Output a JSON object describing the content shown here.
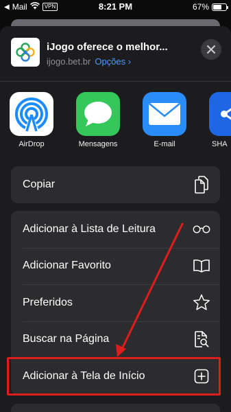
{
  "status_bar": {
    "carrier": "Mail",
    "vpn": "VPN",
    "time": "8:21 PM",
    "battery_percent": "67%",
    "battery_level": 0.67
  },
  "share_header": {
    "title": "iJogo oferece o melhor...",
    "domain": "ijogo.bet.br",
    "options_label": "Opções ›"
  },
  "apps": [
    {
      "label": "AirDrop",
      "icon": "airdrop-icon"
    },
    {
      "label": "Mensagens",
      "icon": "messages-icon"
    },
    {
      "label": "E-mail",
      "icon": "mail-icon"
    },
    {
      "label": "SHA",
      "icon": "shareit-icon"
    }
  ],
  "actions_top": [
    {
      "label": "Copiar",
      "icon": "copy-icon"
    }
  ],
  "actions": [
    {
      "label": "Adicionar à Lista de Leitura",
      "icon": "glasses-icon"
    },
    {
      "label": "Adicionar Favorito",
      "icon": "book-icon"
    },
    {
      "label": "Preferidos",
      "icon": "star-icon"
    },
    {
      "label": "Buscar na Página",
      "icon": "find-in-page-icon"
    },
    {
      "label": "Adicionar à Tela de Início",
      "icon": "add-square-icon"
    }
  ],
  "colors": {
    "sheet_bg": "#1c1c1e",
    "row_bg": "#2c2c2e",
    "link_blue": "#4a9cff",
    "annotation_red": "#e01c1c"
  }
}
